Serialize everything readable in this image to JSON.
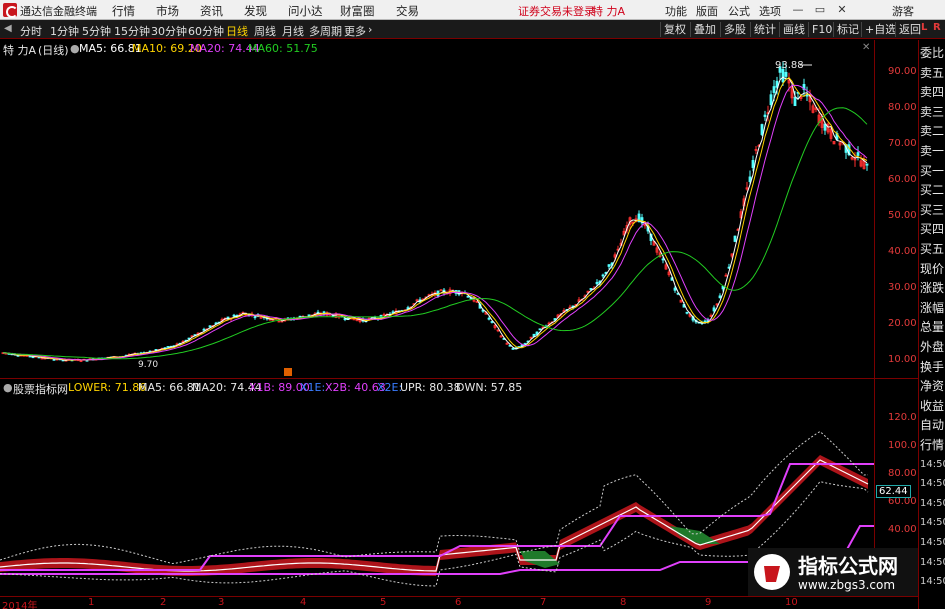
{
  "menubar": {
    "app_title": "通达信金融终端",
    "items": [
      "行情",
      "市场",
      "资讯",
      "发现",
      "问小达",
      "财富圈",
      "交易"
    ],
    "alert": "证券交易未登录",
    "stock_name": "特 力A",
    "right_items": [
      "功能",
      "版面",
      "公式",
      "选项"
    ],
    "guest": "游客"
  },
  "toolbar": {
    "periods": [
      "分时",
      "1分钟",
      "5分钟",
      "15分钟",
      "30分钟",
      "60分钟",
      "日线",
      "周线",
      "月线",
      "多周期",
      "更多"
    ],
    "active": "日线",
    "right_buttons": [
      "复权",
      "叠加",
      "多股",
      "统计",
      "画线",
      "F10",
      "标记",
      "+自选",
      "返回"
    ]
  },
  "main_info": {
    "title": "特 力A",
    "period": "(日线)",
    "ma5": "MA5: 66.81",
    "ma10": "MA10: 69.20",
    "ma20": "MA20: 74.44",
    "ma60": "MA60: 51.75"
  },
  "main_axis": [
    "90.00",
    "80.00",
    "70.00",
    "60.00",
    "50.00",
    "40.00",
    "30.00",
    "20.00",
    "10.00"
  ],
  "main_annotations": {
    "high": "93.88",
    "low": "9.70"
  },
  "sub_info": {
    "title": "股票指标网",
    "lower": "LOWER: 71.86",
    "ma5": "MA5: 66.81",
    "ma20": "MA20: 74.44",
    "x1b": "X1B: 89.00",
    "x1e": "X1E:",
    "x2b": "X2B: 40.63",
    "x2e": "X2E:",
    "upr": "UPR: 80.38",
    "dwn": "DWN: 57.85"
  },
  "sub_axis": [
    "120.0",
    "100.0",
    "80.00",
    "60.00",
    "40.00"
  ],
  "sub_chip": "62.44",
  "x_axis": [
    "2014年",
    "1",
    "2",
    "3",
    "4",
    "5",
    "6",
    "7",
    "8",
    "9",
    "10"
  ],
  "right_panel": {
    "top_label": "L",
    "top_label2": "R",
    "items": [
      "委比",
      "卖五",
      "卖四",
      "卖三",
      "卖二",
      "卖一",
      "买一",
      "买二",
      "买三",
      "买四",
      "买五",
      "现价",
      "涨跌",
      "涨幅",
      "总量",
      "外盘",
      "换手",
      "净资",
      "收益",
      "自动",
      "行情",
      "14:50",
      "14:50",
      "14:50",
      "14:50",
      "14:50",
      "14:50",
      "14:50"
    ]
  },
  "watermark": {
    "line1": "指标公式网",
    "line2": "www.zbgs3.com"
  },
  "colors": {
    "ma5": "#ffffff",
    "ma10": "#ffd400",
    "ma20": "#e040fb",
    "ma60": "#22cc22",
    "up": "#ff3030",
    "down": "#54ffff",
    "axis": "#e23a3a"
  }
}
